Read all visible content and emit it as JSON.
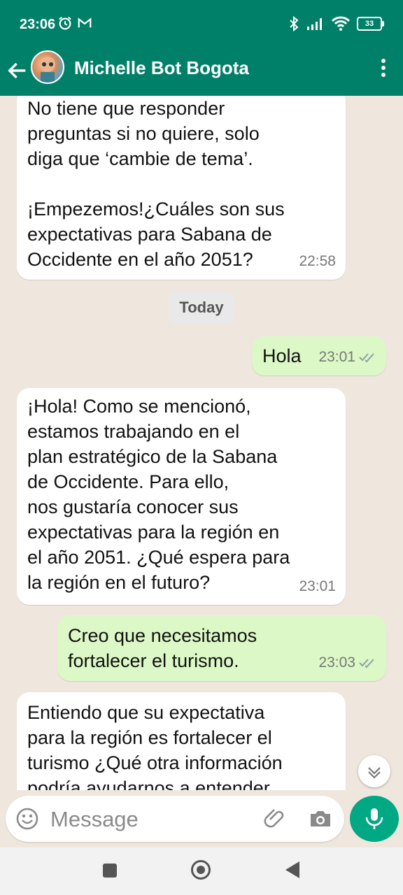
{
  "status": {
    "time": "23:06",
    "battery": "33"
  },
  "header": {
    "title": "Michelle Bot Bogota"
  },
  "messages": [
    {
      "dir": "in",
      "text": "No tiene que responder\npreguntas si no quiere, solo\ndiga que ‘cambie de tema’.\n\n¡Empezemos!¿Cuáles son sus\nexpectativas para Sabana de\nOccidente en el año 2051?",
      "time": "22:58"
    },
    {
      "dir": "out",
      "text": "Hola",
      "time": "23:01"
    },
    {
      "dir": "in",
      "text": "¡Hola! Como se mencionó,\nestamos trabajando en el\nplan estratégico de la Sabana\nde Occidente. Para ello,\nnos gustaría conocer sus\nexpectativas para la región en\nel año 2051. ¿Qué espera para\nla región en el futuro?",
      "time": "23:01"
    },
    {
      "dir": "out",
      "text": "Creo que necesitamos\nfortalecer el turismo.",
      "time": "23:03"
    },
    {
      "dir": "in",
      "text": "Entiendo que su expectativa\npara la región es fortalecer el\nturismo ¿Qué otra información\npodría ayudarnos a entender",
      "time": ""
    }
  ],
  "date_chip": "Today",
  "composer": {
    "placeholder": "Message"
  },
  "colors": {
    "brand": "#008069",
    "accent": "#00a884",
    "outgoing": "#dcf8c6",
    "background": "#efe7de"
  },
  "icons": [
    "back-arrow-icon",
    "overflow-menu-icon",
    "emoji-icon",
    "attach-icon",
    "camera-icon",
    "mic-icon",
    "double-check-icon",
    "chevron-down-icon"
  ]
}
